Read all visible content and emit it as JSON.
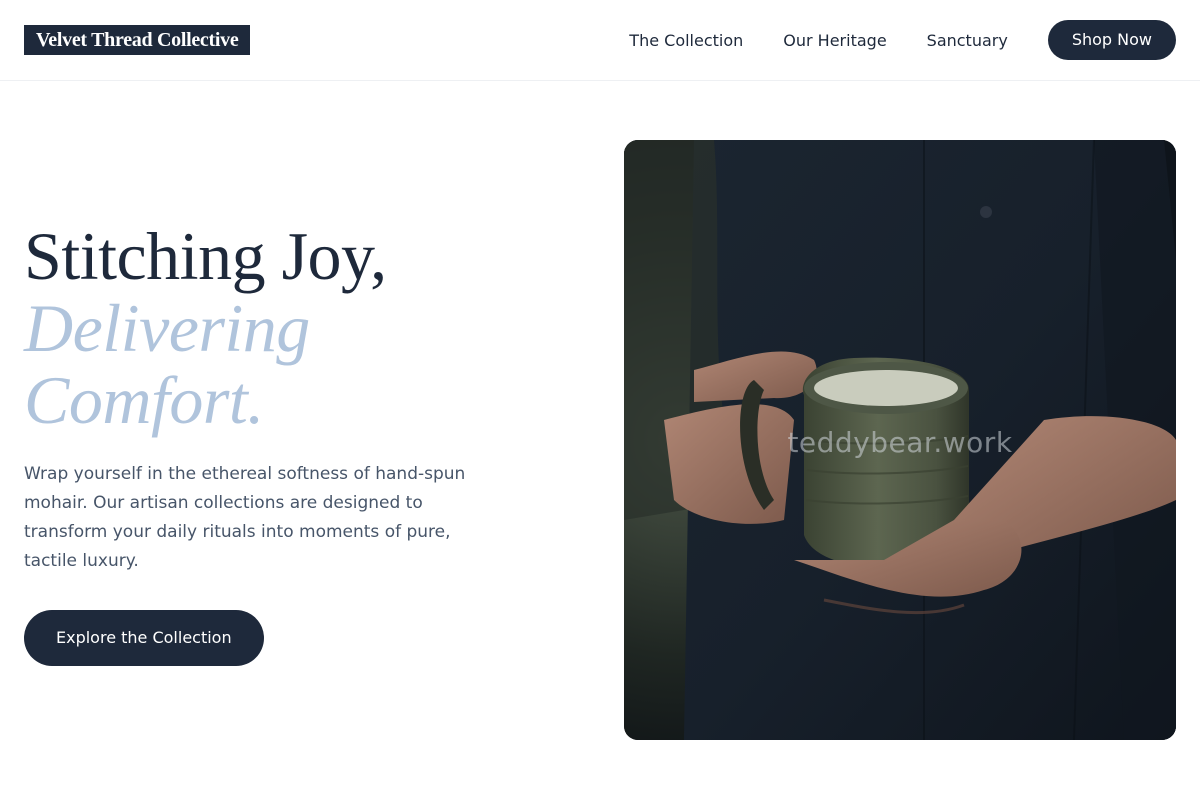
{
  "header": {
    "logo": "Velvet Thread Collective",
    "nav": [
      {
        "label": "The Collection"
      },
      {
        "label": "Our Heritage"
      },
      {
        "label": "Sanctuary"
      }
    ],
    "shop_button": "Shop Now"
  },
  "hero": {
    "headline_line1": "Stitching Joy,",
    "headline_line2": "Delivering",
    "headline_line3": "Comfort.",
    "description": "Wrap yourself in the ethereal softness of hand-spun mohair. Our artisan collections are designed to transform your daily rituals into moments of pure, tactile luxury.",
    "cta_label": "Explore the Collection",
    "image_watermark": "teddybear.work"
  },
  "colors": {
    "primary": "#1e293b",
    "accent": "#b0c4dc",
    "body_text": "#475569"
  }
}
